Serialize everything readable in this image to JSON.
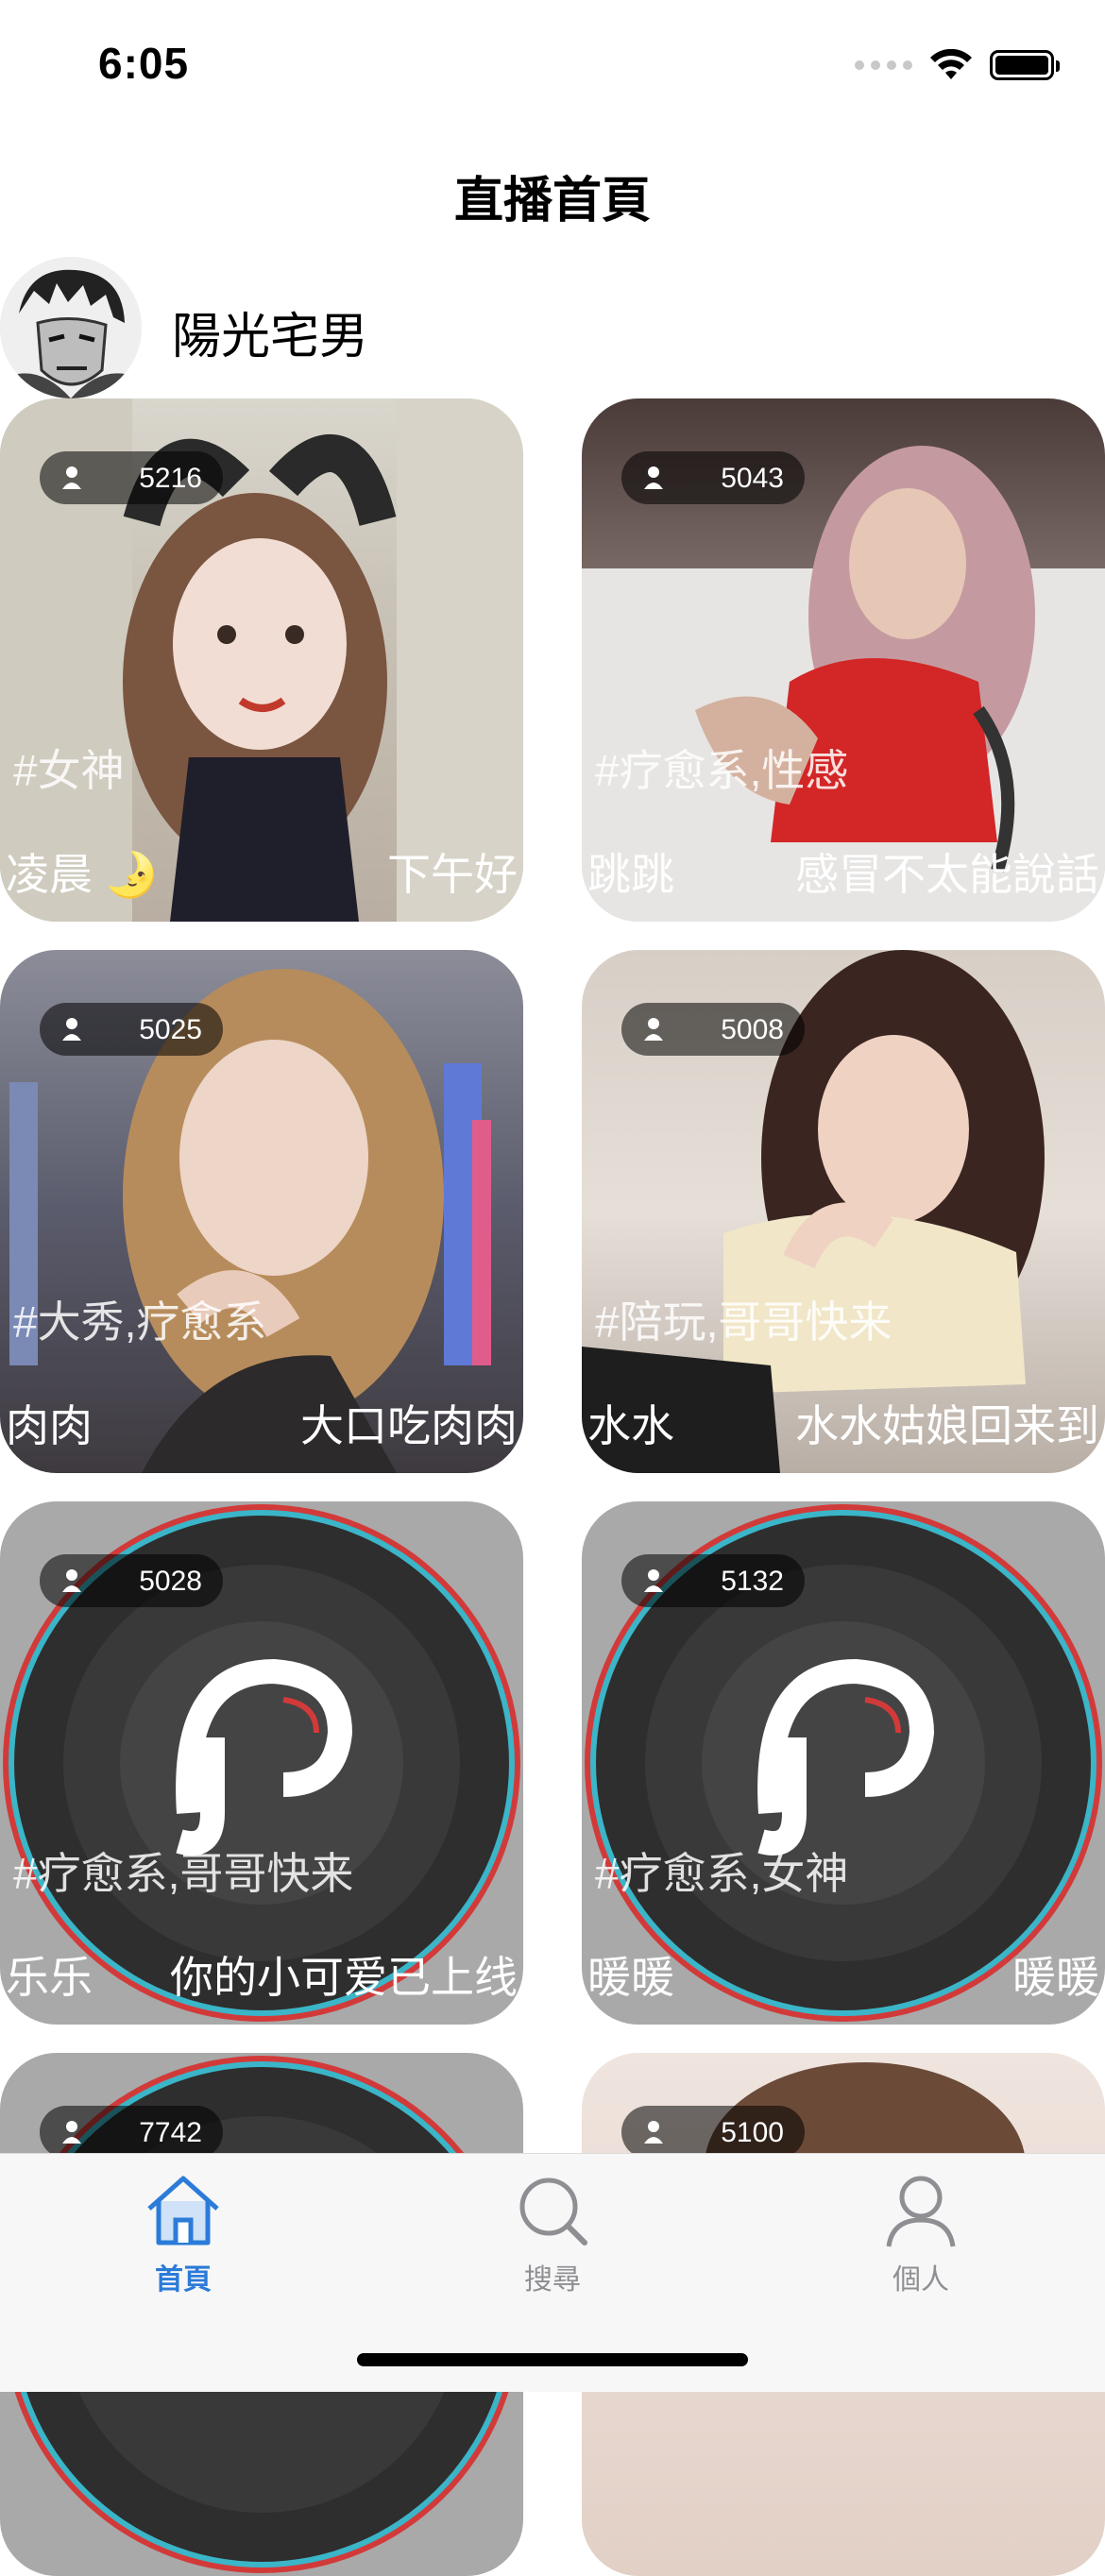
{
  "status_bar": {
    "time": "6:05"
  },
  "header": {
    "title": "直播首頁"
  },
  "user": {
    "name": "陽光宅男"
  },
  "cards": [
    {
      "viewers": "5216",
      "tags": "#女神",
      "nickname": "凌晨 🌛",
      "status": "下午好"
    },
    {
      "viewers": "5043",
      "tags": "#疗愈系,性感",
      "nickname": "跳跳",
      "status": "感冒不太能說話"
    },
    {
      "viewers": "5025",
      "tags": "#大秀,疗愈系",
      "nickname": "肉肉",
      "status": "大口吃肉肉"
    },
    {
      "viewers": "5008",
      "tags": "#陪玩,哥哥快来",
      "nickname": "水水",
      "status": "水水姑娘回来到"
    },
    {
      "viewers": "5028",
      "tags": "#疗愈系,哥哥快来",
      "nickname": "乐乐",
      "status": "你的小可爱已上线"
    },
    {
      "viewers": "5132",
      "tags": "#疗愈系,女神",
      "nickname": "暖暖",
      "status": "暖暖"
    },
    {
      "viewers": "7742",
      "tags": "",
      "nickname": "",
      "status": ""
    },
    {
      "viewers": "5100",
      "tags": "",
      "nickname": "",
      "status": ""
    }
  ],
  "tab_bar": {
    "tabs": [
      {
        "label": "首頁",
        "icon": "home-icon",
        "active": true
      },
      {
        "label": "搜尋",
        "icon": "search-icon",
        "active": false
      },
      {
        "label": "個人",
        "icon": "person-icon",
        "active": false
      }
    ],
    "active_color": "#2b7bd9",
    "inactive_color": "#8e8e93"
  }
}
